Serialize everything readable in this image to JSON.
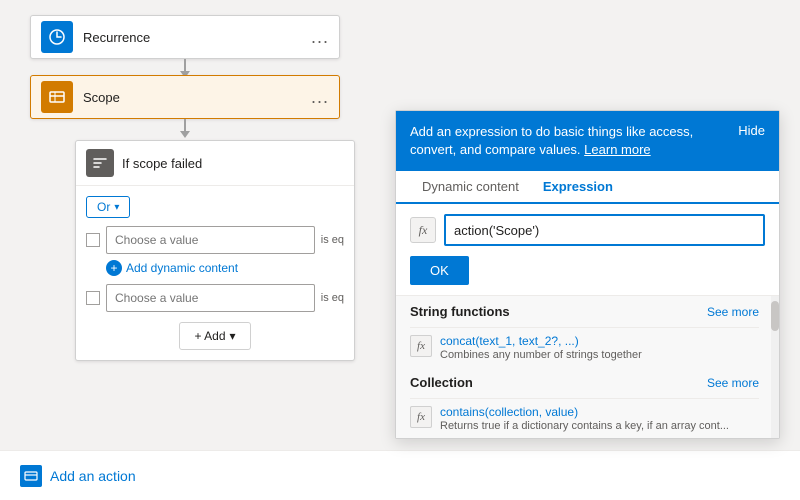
{
  "flow": {
    "recurrence": {
      "label": "Recurrence",
      "more": "..."
    },
    "scope": {
      "label": "Scope",
      "more": "..."
    },
    "condition": {
      "label": "If scope failed",
      "or_label": "Or",
      "choose_value_placeholder": "Choose a value",
      "is_equal_label": "is eq",
      "add_dynamic_label": "Add dynamic content",
      "add_label": "+ Add"
    },
    "bottom_bar": {
      "add_action_label": "Add an action"
    }
  },
  "expr_panel": {
    "header_text": "Add an expression to do basic things like access, convert, and compare values.",
    "learn_more": "Learn more",
    "hide_label": "Hide",
    "tab_dynamic": "Dynamic content",
    "tab_expression": "Expression",
    "input_value": "action('Scope')",
    "fx_label": "fx",
    "ok_label": "OK",
    "string_functions": {
      "title": "String functions",
      "see_more": "See more",
      "items": [
        {
          "name": "concat(text_1, text_2?, ...)",
          "desc": "Combines any number of strings together"
        }
      ]
    },
    "collection": {
      "title": "Collection",
      "see_more": "See more",
      "items": [
        {
          "name": "contains(collection, value)",
          "desc": "Returns true if a dictionary contains a key, if an array cont..."
        }
      ]
    }
  }
}
